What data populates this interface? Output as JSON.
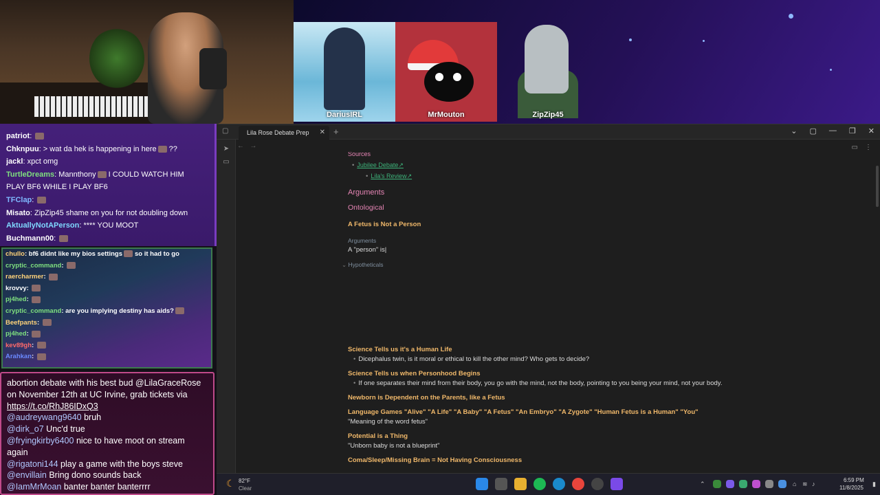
{
  "stream": {
    "participants": [
      "DariusIRL",
      "MrMouton",
      "ZipZip45"
    ]
  },
  "chat_top": [
    {
      "user": "patriot",
      "text": "",
      "color": "#ffffff",
      "emote": true
    },
    {
      "user": "Chknpuu",
      "text": "> wat da hek is happening in here",
      "color": "#ffffff",
      "suffix": "??"
    },
    {
      "user": "jackl",
      "text": "xpct omg",
      "color": "#ffffff"
    },
    {
      "user": "TurtleDreams",
      "text": "Mannthony",
      "color": "#7fe07f",
      "suffix": "I COULD WATCH HIM"
    },
    {
      "user": "",
      "text": "PLAY BF6 WHILE I PLAY BF6",
      "color": "#ffffff"
    },
    {
      "user": "TFClap",
      "text": "",
      "color": "#7fb8ff",
      "emote": true
    },
    {
      "user": "Misato",
      "text": "ZipZip45 shame on you for not doubling down",
      "color": "#ffffff"
    },
    {
      "user": "AktuallyNotAPerson",
      "text": "**** YOU MOOT",
      "color": "#7fd8ff"
    },
    {
      "user": "Buchmann00",
      "text": "",
      "color": "#ffffff",
      "emote": true
    }
  ],
  "chat_mid": [
    {
      "user": "chullo",
      "text": "bf6 didnt like my bios settings",
      "suffix": "so it had to go",
      "color": "#ffd27a"
    },
    {
      "user": "cryptic_command",
      "text": "",
      "color": "#7fe07f",
      "emote": true
    },
    {
      "user": "raercharmer",
      "text": "",
      "color": "#ffd27a",
      "emote": true
    },
    {
      "user": "krovvy",
      "text": "",
      "color": "#ffffff",
      "emote": true
    },
    {
      "user": "pj4hed",
      "text": "",
      "color": "#7fe07f",
      "emote": true
    },
    {
      "user": "cryptic_command",
      "text": "are you implying destiny has aids?",
      "color": "#7fe07f",
      "emote": true
    },
    {
      "user": "Beefpants",
      "text": "",
      "color": "#ffd27a",
      "emote": true
    },
    {
      "user": "pj4hed",
      "text": "",
      "color": "#7fe07f",
      "emote": true
    },
    {
      "user": "kev89gh",
      "text": "",
      "color": "#ff6a6a",
      "emote": true
    },
    {
      "user": "Arahkan",
      "text": "",
      "color": "#6a8aff",
      "emote": true
    }
  ],
  "chat_bottom": {
    "lines": [
      {
        "handle": "",
        "text": "abortion debate with his best bud @LilaGraceRose on November 12th at UC Irvine, grab tickets via ",
        "link": "https://t.co/RhJ86IDxQ3"
      },
      {
        "handle": "@audreywang9640",
        "text": "bruh"
      },
      {
        "handle": "@dirk_o7",
        "text": "Unc'd true"
      },
      {
        "handle": "@fryingkirby6400",
        "text": "nice to have moot on stream again"
      },
      {
        "handle": "@rigatoni144",
        "text": "play a game with the boys steve"
      },
      {
        "handle": "@envillain",
        "text": "Bring dono sounds back"
      },
      {
        "handle": "@IamMrMoan",
        "text": "banter banter banterrrr"
      }
    ]
  },
  "obsidian": {
    "tab_title": "Lila Rose Debate Prep",
    "sources_heading": "Sources",
    "link1": "Jubilee Debate",
    "link2": "Lila's Review",
    "h_arguments": "Arguments",
    "h_ontological": "Ontological",
    "h_fetus": "A Fetus is Not a Person",
    "sub_arguments": "Arguments",
    "person_line": "A \"person\" is",
    "hypotheticals": "Hypotheticals",
    "sections": [
      {
        "title": "Science Tells us it's a Human Life",
        "bullet": "Dicephalus twin, is it moral or ethical to kill the other mind? Who gets to decide?",
        "quote": ""
      },
      {
        "title": "Science Tells us when Personhood Begins",
        "bullet": "If one separates their mind from their body, you go with the mind, not the body, pointing to you being your mind, not your body.",
        "quote": ""
      },
      {
        "title": "Newborn is Dependent on the Parents, like a Fetus",
        "bullet": "",
        "quote": ""
      },
      {
        "title": "Language Games \"Alive\" \"A Life\" \"A Baby\" \"A Fetus\" \"An Embryo\" \"A Zygote\" \"Human Fetus is a Human\" \"You\"",
        "bullet": "",
        "quote": "\"Meaning of the word fetus\""
      },
      {
        "title": "Potential is a Thing",
        "bullet": "",
        "quote": "\"Unborn baby is not a blueprint\""
      },
      {
        "title": "Coma/Sleep/Missing Brain = Not Having Consciousness",
        "bullet": "",
        "quote": ""
      }
    ]
  },
  "taskbar": {
    "temp": "82°F",
    "weather": "Clear",
    "time": "6:59 PM",
    "date": "11/8/2025"
  }
}
